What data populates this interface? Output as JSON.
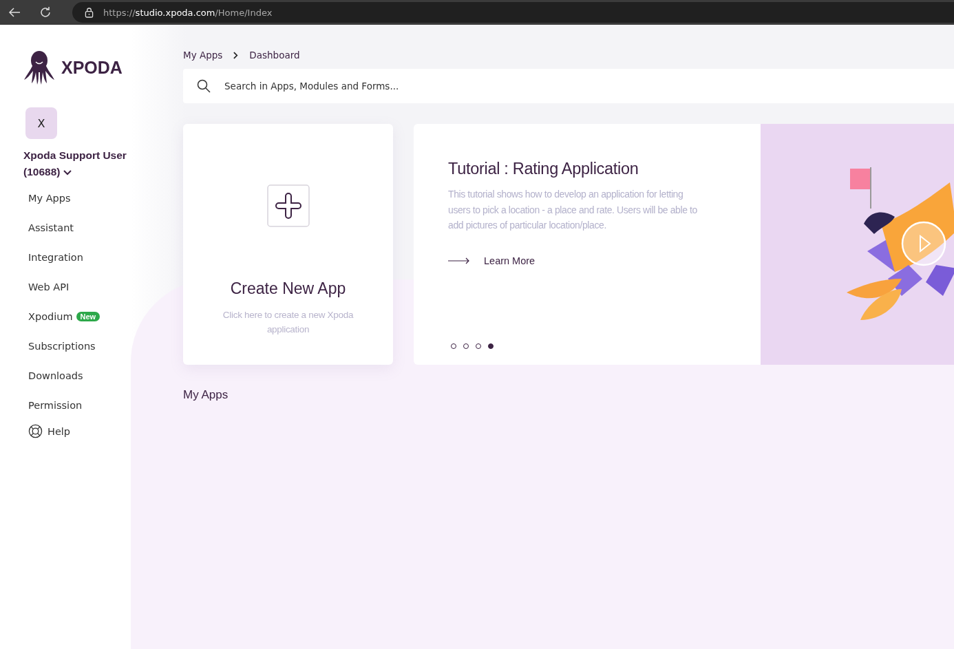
{
  "browser": {
    "url": "https://**studio.xpoda.com**/Home/Index"
  },
  "sidebar": {
    "logo": "XPODA",
    "avatar": "X",
    "user": "Xpoda Support User (10688)",
    "items": [
      {
        "label": "My Apps"
      },
      {
        "label": "Assistant"
      },
      {
        "label": "Integration"
      },
      {
        "label": "Web API"
      },
      {
        "label": "Xpodium",
        "badge": "New"
      },
      {
        "label": "Subscriptions"
      },
      {
        "label": "Downloads"
      },
      {
        "label": "Permission"
      }
    ],
    "help": "Help"
  },
  "breadcrumb": [
    "My Apps",
    "Dashboard"
  ],
  "search": {
    "placeholder": "Search in Apps, Modules and Forms..."
  },
  "create_card": {
    "title": "Create New App",
    "subtitle": "Click here to create a new Xpoda application"
  },
  "tutorial": {
    "title": "Tutorial : Rating Application",
    "text": "This tutorial shows how to develop an application for letting users to pick a location - a place and rate. Users will be able to add pictures of particular location/place.",
    "link": "Learn More",
    "dots": [
      {
        "selected": false
      },
      {
        "selected": false
      },
      {
        "selected": false
      },
      {
        "selected": true
      }
    ]
  },
  "section_title": "My Apps"
}
